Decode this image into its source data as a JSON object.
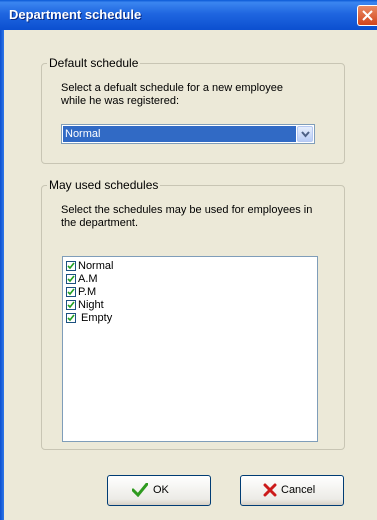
{
  "window": {
    "title": "Department schedule"
  },
  "default_group": {
    "title": "Default schedule",
    "description": [
      "Select a defualt schedule for a new employee",
      "while he was registered:"
    ],
    "selected_value": "Normal"
  },
  "used_group": {
    "title": "May used schedules",
    "description": [
      "Select the schedules may be used for employees in",
      "the department."
    ],
    "items": [
      {
        "label": "Normal",
        "checked": true
      },
      {
        "label": "A.M",
        "checked": true
      },
      {
        "label": "P.M",
        "checked": true
      },
      {
        "label": "Night",
        "checked": true
      },
      {
        "label": " Empty",
        "checked": true
      }
    ]
  },
  "buttons": {
    "ok": "OK",
    "cancel": "Cancel"
  },
  "colors": {
    "titlebar": "#0b4fd0",
    "selection": "#316ac5",
    "ok_icon": "#2e9a1f",
    "cancel_icon": "#cc1a1a"
  }
}
